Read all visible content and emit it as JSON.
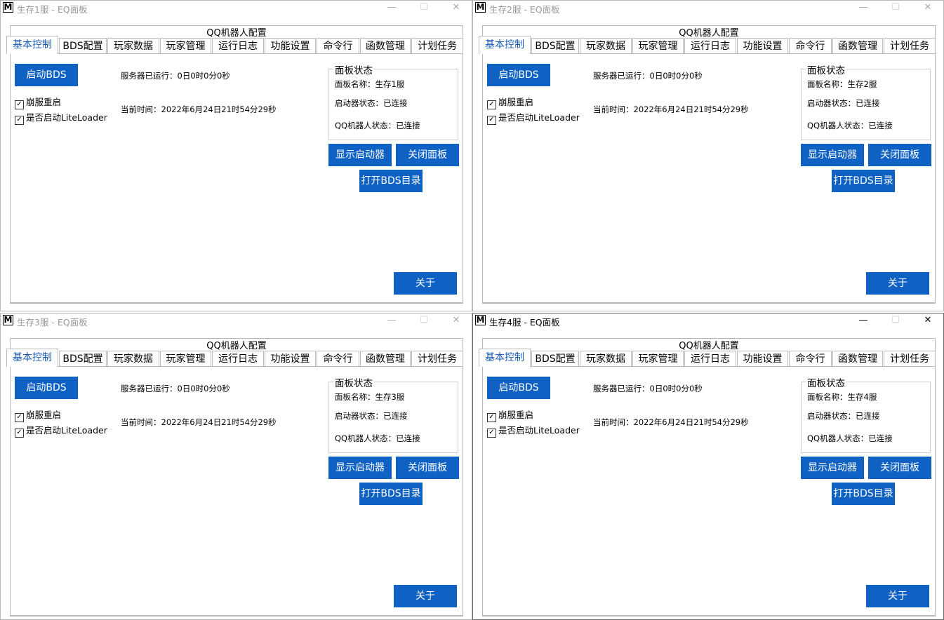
{
  "windows": [
    {
      "title": "生存1服 - EQ面板",
      "panel_name": "面板名称：生存1服"
    },
    {
      "title": "生存2服 - EQ面板",
      "panel_name": "面板名称：生存2服"
    },
    {
      "title": "生存3服 - EQ面板",
      "panel_name": "面板名称：生存3服"
    },
    {
      "title": "生存4服 - EQ面板",
      "panel_name": "面板名称：生存4服"
    }
  ],
  "common": {
    "app_icon_letter": "M",
    "minimize_glyph": "—",
    "maximize_glyph": "☐",
    "close_glyph": "✕",
    "group_title": "QQ机器人配置",
    "tabs": [
      "基本控制",
      "BDS配置",
      "玩家数据",
      "玩家管理",
      "运行日志",
      "功能设置",
      "命令行",
      "函数管理",
      "计划任务"
    ],
    "start_bds": "启动BDS",
    "crash_restart": "崩服重启",
    "enable_liteloader": "是否启动LiteLoader",
    "checkbox_mark": "✓",
    "uptime": "服务器已运行：0日0时0分0秒",
    "current_time": "当前时间：2022年6月24日21时54分29秒",
    "panel_status_title": "面板状态",
    "launcher_status": "启动器状态：已连接",
    "qqbot_status": "QQ机器人状态：已连接",
    "show_launcher": "显示启动器",
    "close_panel": "关闭面板",
    "open_bds_dir": "打开BDS目录",
    "about": "关于"
  },
  "colors": {
    "button_bg": "#0f62c3",
    "selected_tab_text": "#1a5cb5"
  }
}
